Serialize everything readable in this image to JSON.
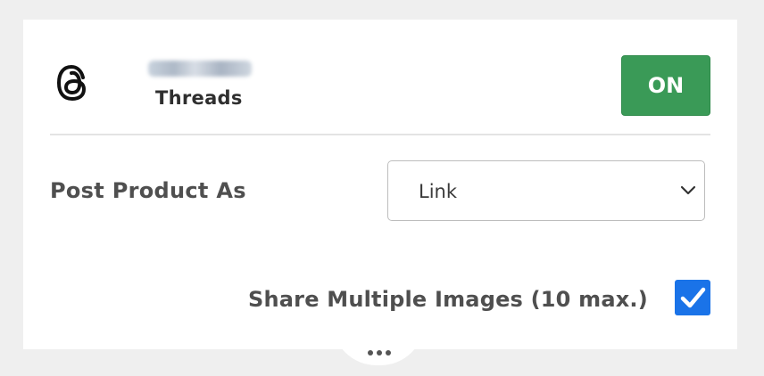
{
  "account": {
    "network": "Threads",
    "toggle_label": "ON",
    "accent_color": "#3a9a57"
  },
  "post_product": {
    "label": "Post Product As",
    "selected": "Link"
  },
  "share_images": {
    "label": "Share Multiple Images (10 max.)",
    "checked": true,
    "checkbox_color": "#1a73e8"
  },
  "icons": {
    "network_icon": "threads-logo-icon",
    "dropdown_icon": "chevron-down-icon",
    "check_icon": "checkmark-icon",
    "more_icon": "ellipsis-icon"
  }
}
